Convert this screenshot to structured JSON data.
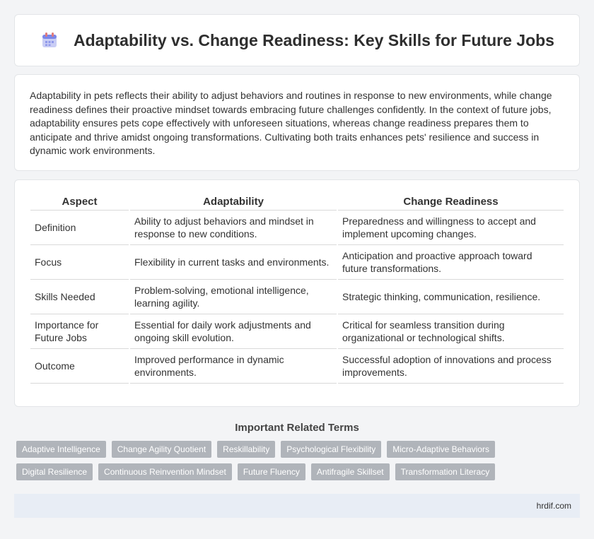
{
  "header": {
    "title": "Adaptability vs. Change Readiness: Key Skills for Future Jobs",
    "icon": "calendar-icon"
  },
  "intro": {
    "text": "Adaptability in pets reflects their ability to adjust behaviors and routines in response to new environments, while change readiness defines their proactive mindset towards embracing future challenges confidently. In the context of future jobs, adaptability ensures pets cope effectively with unforeseen situations, whereas change readiness prepares them to anticipate and thrive amidst ongoing transformations. Cultivating both traits enhances pets' resilience and success in dynamic work environments."
  },
  "table": {
    "headers": [
      "Aspect",
      "Adaptability",
      "Change Readiness"
    ],
    "rows": [
      [
        "Definition",
        "Ability to adjust behaviors and mindset in response to new conditions.",
        "Preparedness and willingness to accept and implement upcoming changes."
      ],
      [
        "Focus",
        "Flexibility in current tasks and environments.",
        "Anticipation and proactive approach toward future transformations."
      ],
      [
        "Skills Needed",
        "Problem-solving, emotional intelligence, learning agility.",
        "Strategic thinking, communication, resilience."
      ],
      [
        "Importance for Future Jobs",
        "Essential for daily work adjustments and ongoing skill evolution.",
        "Critical for seamless transition during organizational or technological shifts."
      ],
      [
        "Outcome",
        "Improved performance in dynamic environments.",
        "Successful adoption of innovations and process improvements."
      ]
    ]
  },
  "related": {
    "title": "Important Related Terms",
    "tags": [
      "Adaptive Intelligence",
      "Change Agility Quotient",
      "Reskillability",
      "Psychological Flexibility",
      "Micro-Adaptive Behaviors",
      "Digital Resilience",
      "Continuous Reinvention Mindset",
      "Future Fluency",
      "Antifragile Skillset",
      "Transformation Literacy"
    ]
  },
  "footer": {
    "site": "hrdif.com"
  }
}
